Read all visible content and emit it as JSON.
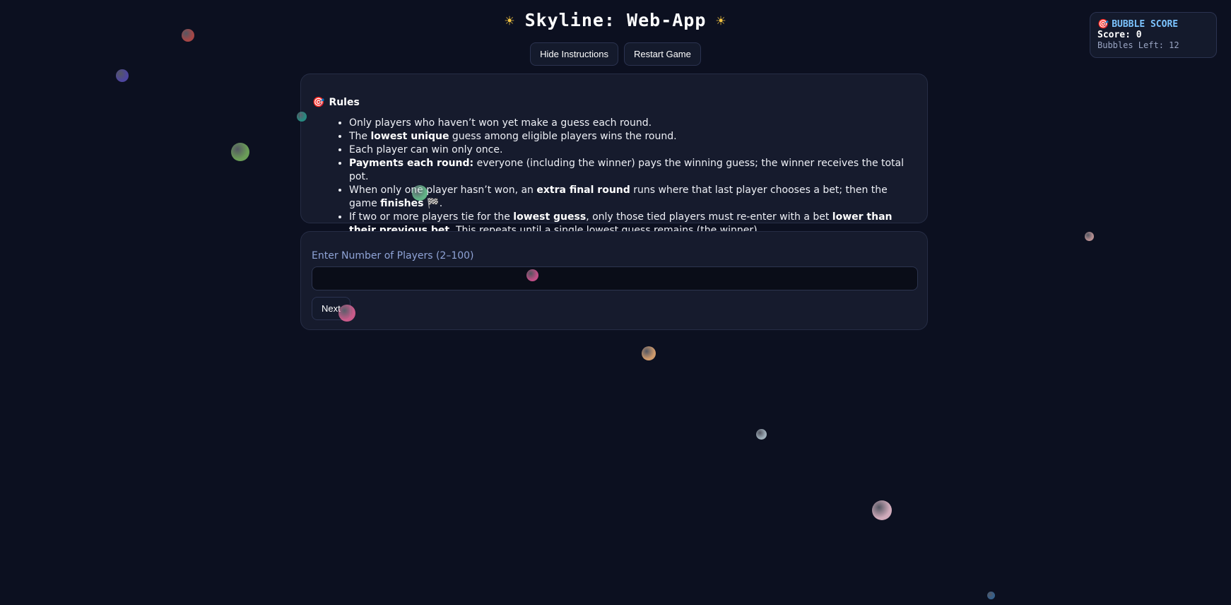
{
  "title": "Skyline: Web-App",
  "icons": {
    "sun": "☀",
    "target": "🎯",
    "checkered_flag": "🏁"
  },
  "buttons": {
    "hide_instructions": "Hide Instructions",
    "restart_game": "Restart Game",
    "next": "Next"
  },
  "rules": {
    "heading": "Rules",
    "items": [
      {
        "before": "Only players who haven’t won yet make a guess each round.",
        "bold1": "",
        "mid": "",
        "bold2": "",
        "after": ""
      },
      {
        "before": "The ",
        "bold1": "lowest unique",
        "mid": " guess among eligible players wins the round.",
        "bold2": "",
        "after": ""
      },
      {
        "before": "Each player can win only once.",
        "bold1": "",
        "mid": "",
        "bold2": "",
        "after": ""
      },
      {
        "before": "",
        "bold1": "Payments each round:",
        "mid": " everyone (including the winner) pays the winning guess; the winner receives the total pot.",
        "bold2": "",
        "after": ""
      },
      {
        "before": "When only one player hasn’t won, an ",
        "bold1": "extra final round",
        "mid": " runs where that last player chooses a bet; then the game ",
        "bold2": "finishes 🏁",
        "after": "."
      },
      {
        "before": "If two or more players tie for the ",
        "bold1": "lowest guess",
        "mid": ", only those tied players must re-enter with a bet ",
        "bold2": "lower than their previous bet",
        "after": ". This repeats until a single lowest guess remains (the winner)."
      }
    ]
  },
  "setup": {
    "label": "Enter Number of Players (2–100)",
    "value": "",
    "placeholder": ""
  },
  "score_panel": {
    "title": "BUBBLE SCORE",
    "score_label": "Score:",
    "score": "0",
    "bubbles_label": "Bubbles Left:",
    "bubbles_left": "12"
  },
  "bubble_colors": [
    "#c0504d",
    "#5a4fb5",
    "#2a9d8f",
    "#7bb661",
    "#d4a5a5",
    "#e05a9a",
    "#f0b27a",
    "#b8c9d4",
    "#f3c6d6",
    "#3c6e9f",
    "#6fcf97",
    "#e8669a"
  ]
}
